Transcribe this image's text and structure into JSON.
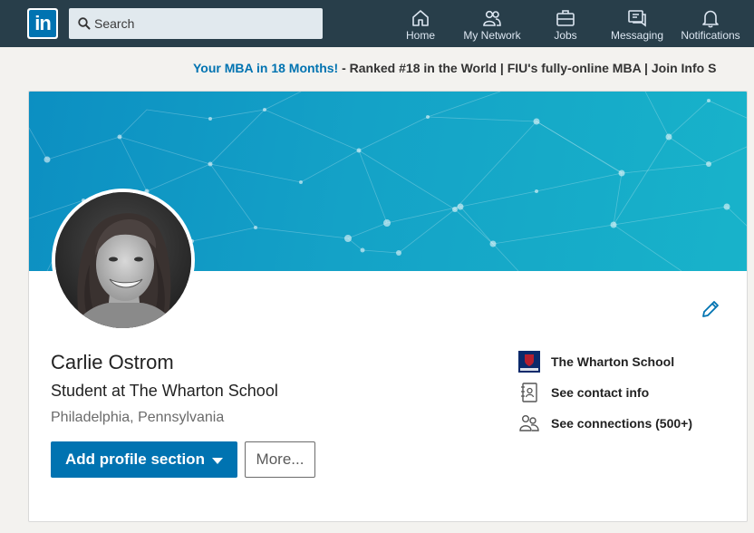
{
  "nav": {
    "logo_text": "in",
    "search_placeholder": "Search",
    "items": [
      {
        "label": "Home",
        "icon": "home-icon"
      },
      {
        "label": "My Network",
        "icon": "network-icon"
      },
      {
        "label": "Jobs",
        "icon": "briefcase-icon"
      },
      {
        "label": "Messaging",
        "icon": "messaging-icon"
      },
      {
        "label": "Notifications",
        "icon": "bell-icon"
      }
    ]
  },
  "promo": {
    "link": "Your MBA in 18 Months!",
    "text": " - Ranked #18 in the World | FIU's fully-online MBA | Join Info S"
  },
  "profile": {
    "name": "Carlie Ostrom",
    "headline": "Student at The Wharton School",
    "location": "Philadelphia, Pennsylvania",
    "add_section_label": "Add profile section",
    "more_label": "More..."
  },
  "side": {
    "school": "The Wharton School",
    "school_logo_text": "Wharton",
    "contact": "See contact info",
    "connections": "See connections (500+)"
  },
  "colors": {
    "nav_bg": "#283e4a",
    "brand_blue": "#0073b1",
    "banner_start": "#0c8fc2",
    "banner_end": "#18b3ca"
  }
}
